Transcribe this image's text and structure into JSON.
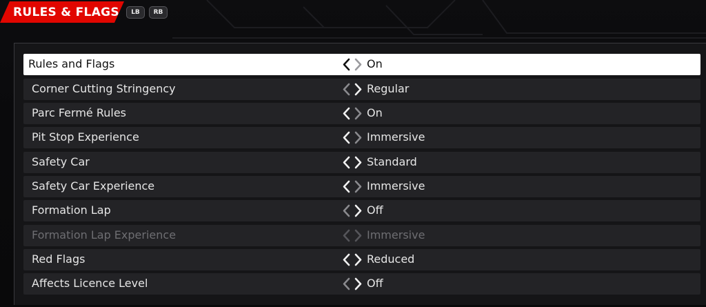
{
  "header": {
    "title": "RULES & FLAGS",
    "bumpers": [
      "LB",
      "RB"
    ]
  },
  "colors": {
    "accent": "#e10600",
    "row_bg": "#232326",
    "row_selected_bg": "#ffffff",
    "text": "#e6e6e6",
    "text_disabled": "#6e6e72",
    "arrow_bright": "#f2f2f2",
    "arrow_dim": "#8a8a8e"
  },
  "settings": [
    {
      "label": "Rules and Flags",
      "value": "On",
      "selected": true,
      "disabled": false,
      "left_arrow": "bright",
      "right_arrow": "dim"
    },
    {
      "label": "Corner Cutting Stringency",
      "value": "Regular",
      "selected": false,
      "disabled": false,
      "left_arrow": "dim",
      "right_arrow": "bright"
    },
    {
      "label": "Parc Fermé Rules",
      "value": "On",
      "selected": false,
      "disabled": false,
      "left_arrow": "bright",
      "right_arrow": "dim"
    },
    {
      "label": "Pit Stop Experience",
      "value": "Immersive",
      "selected": false,
      "disabled": false,
      "left_arrow": "bright",
      "right_arrow": "dim"
    },
    {
      "label": "Safety Car",
      "value": "Standard",
      "selected": false,
      "disabled": false,
      "left_arrow": "bright",
      "right_arrow": "bright"
    },
    {
      "label": "Safety Car Experience",
      "value": "Immersive",
      "selected": false,
      "disabled": false,
      "left_arrow": "bright",
      "right_arrow": "dim"
    },
    {
      "label": "Formation Lap",
      "value": "Off",
      "selected": false,
      "disabled": false,
      "left_arrow": "dim",
      "right_arrow": "bright"
    },
    {
      "label": "Formation Lap Experience",
      "value": "Immersive",
      "selected": false,
      "disabled": true,
      "left_arrow": "dim",
      "right_arrow": "dim"
    },
    {
      "label": "Red Flags",
      "value": "Reduced",
      "selected": false,
      "disabled": false,
      "left_arrow": "bright",
      "right_arrow": "bright"
    },
    {
      "label": "Affects Licence Level",
      "value": "Off",
      "selected": false,
      "disabled": false,
      "left_arrow": "dim",
      "right_arrow": "bright"
    }
  ]
}
